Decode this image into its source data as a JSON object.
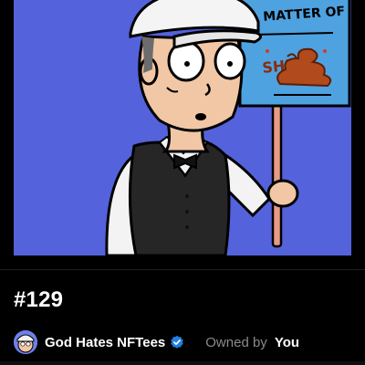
{
  "nft": {
    "token_id": "#129",
    "artwork": {
      "description_icon": "cartoon-character-holding-sign",
      "sign_line1": "A MATTER OF",
      "sign_line2": "SHIT",
      "background_color": "#5462dc"
    }
  },
  "collection": {
    "name": "God Hates NFTees",
    "verified": true,
    "verified_color": "#2081e2"
  },
  "ownership": {
    "label": "Owned by",
    "owner": "You"
  }
}
